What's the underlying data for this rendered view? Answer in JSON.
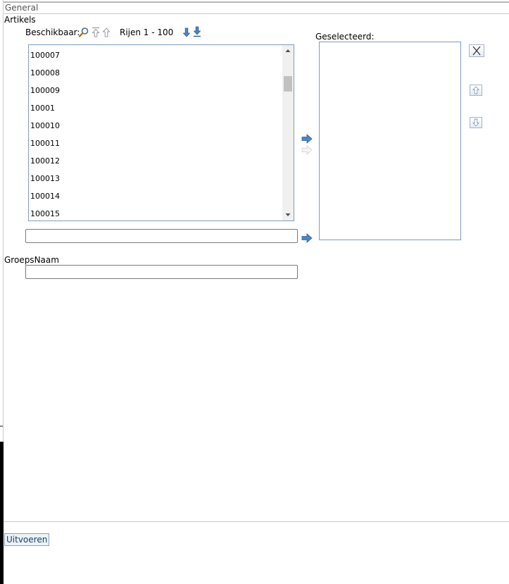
{
  "section": {
    "title": "General"
  },
  "artikels": {
    "label": "Artikels",
    "available_label": "Beschikbaar:",
    "rows_label": "Rijen 1 - 100",
    "items": [
      "100007",
      "100008",
      "100009",
      "10001",
      "100010",
      "100011",
      "100012",
      "100013",
      "100014",
      "100015"
    ],
    "filter_value": "",
    "selected_label": "Geselecteerd:",
    "selected_items": []
  },
  "groepsnaam": {
    "label": "GroepsNaam",
    "value": ""
  },
  "actions": {
    "run_label": "Uitvoeren"
  },
  "colors": {
    "accent": "#4a7fb5",
    "border": "#7f9db9"
  },
  "icons": [
    "search-icon",
    "arrow-first-icon",
    "arrow-up-icon",
    "arrow-down-icon",
    "arrow-last-icon",
    "arrow-right-icon",
    "close-icon"
  ]
}
